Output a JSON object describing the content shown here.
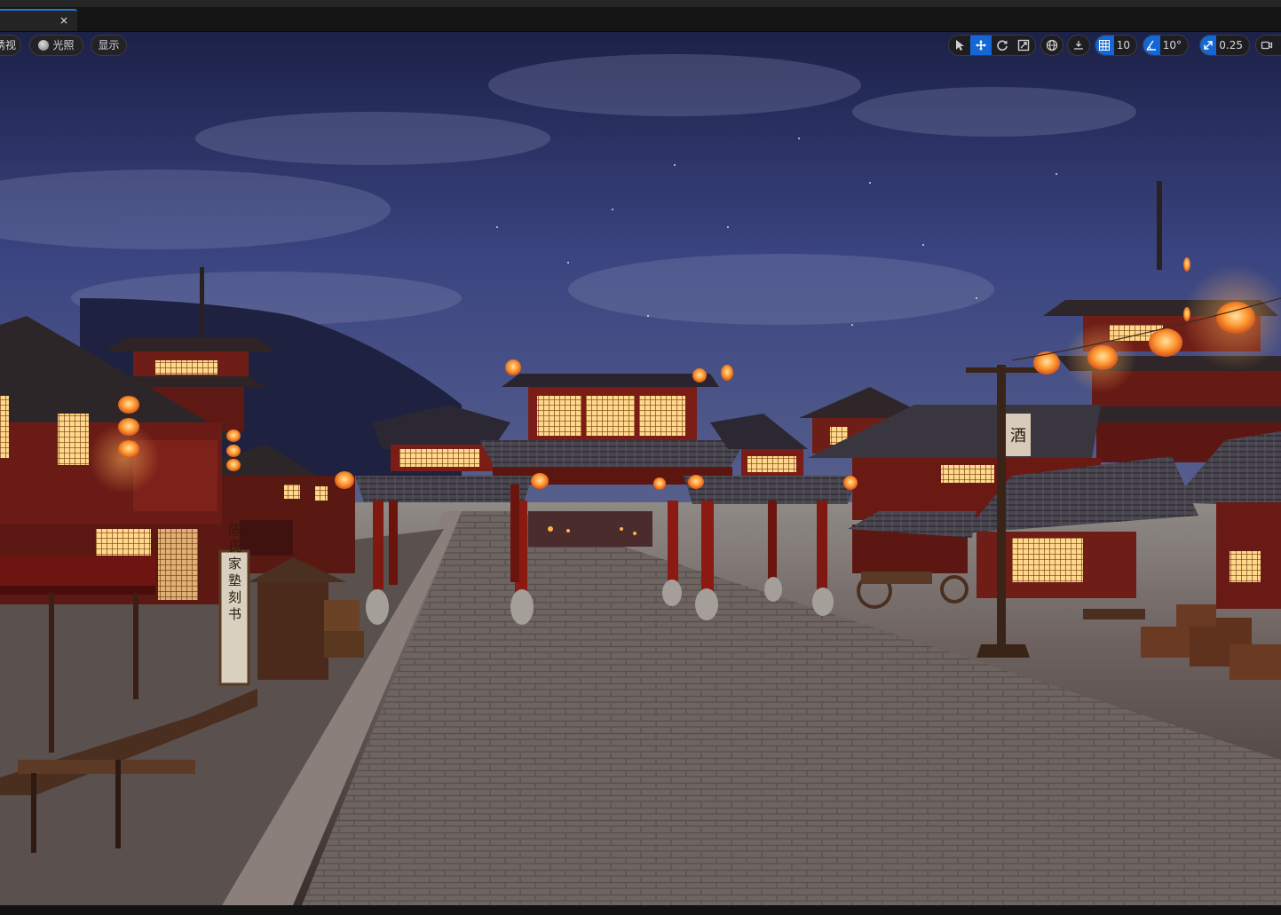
{
  "tabs": [
    {
      "label": "",
      "close_glyph": "×",
      "active": true
    }
  ],
  "viewport_toolbar": {
    "view_mode_label": "透视",
    "view_mode_label_visible": "诱视",
    "lighting_label": "光照",
    "show_label": "显示",
    "grid_snap_value": "10",
    "rotation_snap_value": "10°",
    "scale_snap_value": "0.25"
  },
  "scene": {
    "shop_sign_text": "陈氏家塾刻书",
    "wine_flag_text": "酒"
  },
  "colors": {
    "accent": "#1467d4",
    "lantern": "#ff8a2a",
    "timber": "#7a1d17",
    "sky_top": "#1c2148"
  }
}
